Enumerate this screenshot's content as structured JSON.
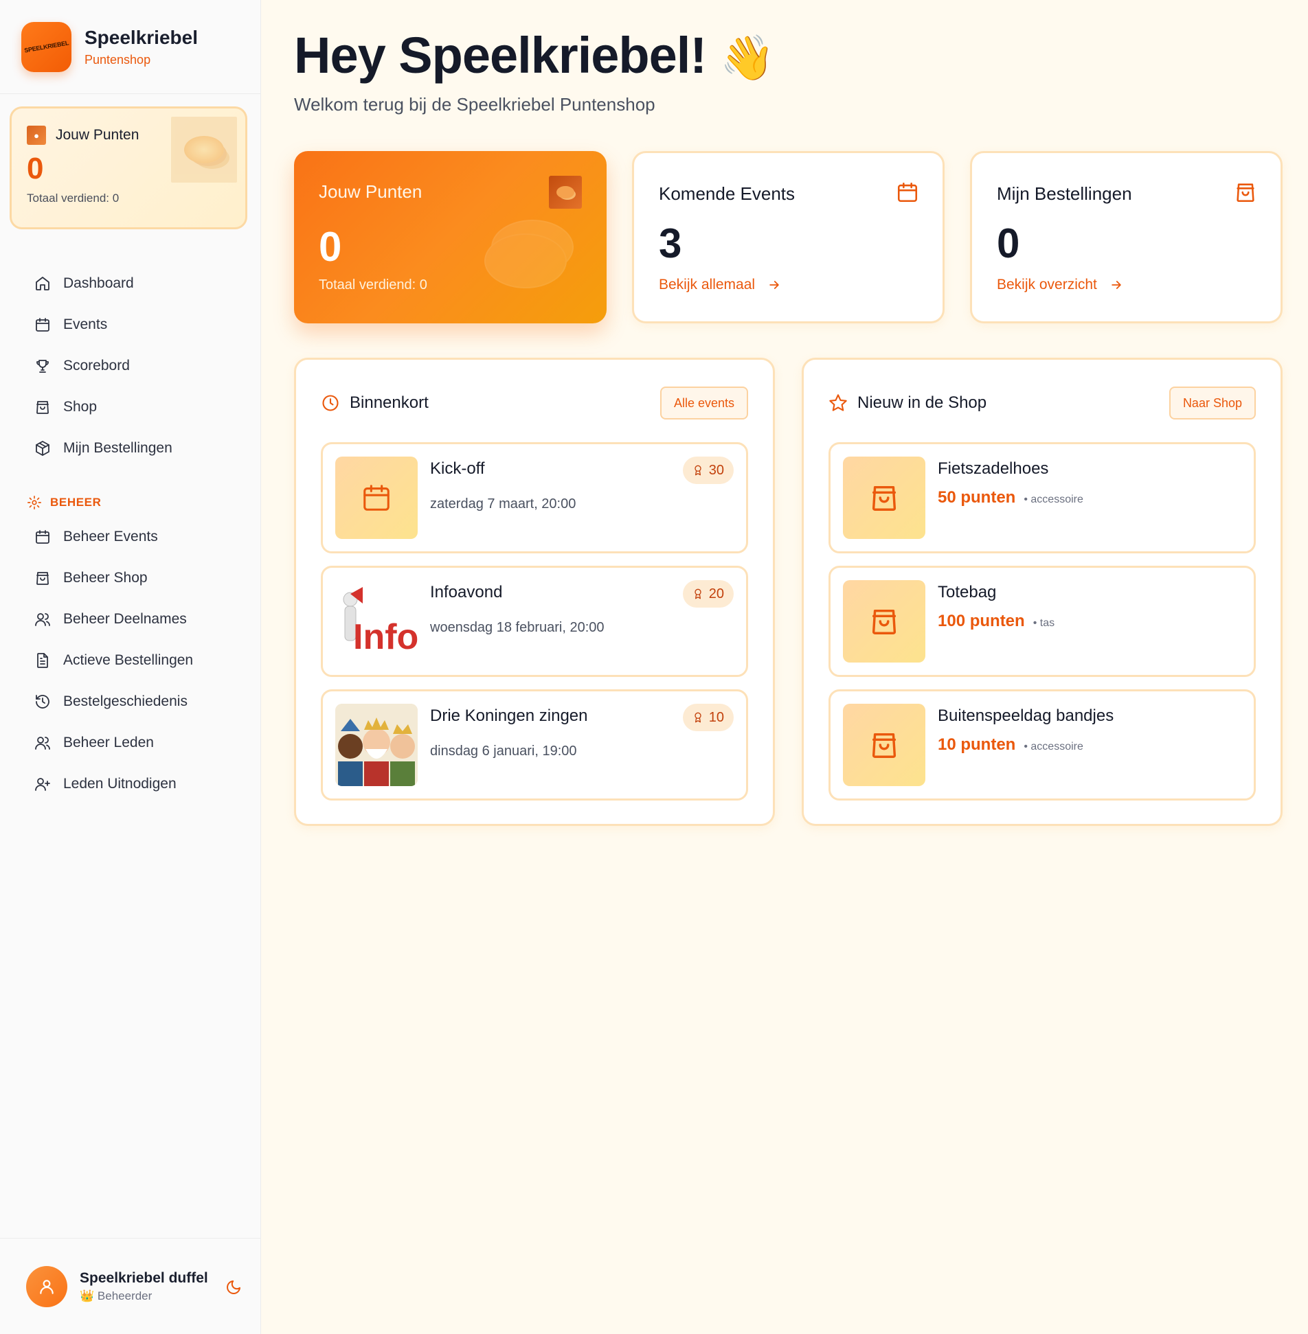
{
  "brand": {
    "name": "Speelkriebel",
    "subtitle": "Puntenshop",
    "logo_text": "SPEELKRIEBEL"
  },
  "sidebar_points": {
    "title": "Jouw Punten",
    "value": "0",
    "total": "Totaal verdiend: 0"
  },
  "nav": {
    "items": [
      {
        "label": "Dashboard",
        "icon": "home-icon"
      },
      {
        "label": "Events",
        "icon": "calendar-icon"
      },
      {
        "label": "Scorebord",
        "icon": "trophy-icon"
      },
      {
        "label": "Shop",
        "icon": "shopping-bag-icon"
      },
      {
        "label": "Mijn Bestellingen",
        "icon": "package-icon"
      }
    ],
    "section_label": "BEHEER",
    "admin_items": [
      {
        "label": "Beheer Events",
        "icon": "calendar-icon"
      },
      {
        "label": "Beheer Shop",
        "icon": "shopping-bag-icon"
      },
      {
        "label": "Beheer Deelnames",
        "icon": "users-icon"
      },
      {
        "label": "Actieve Bestellingen",
        "icon": "file-text-icon"
      },
      {
        "label": "Bestelgeschiedenis",
        "icon": "history-icon"
      },
      {
        "label": "Beheer Leden",
        "icon": "users-icon"
      },
      {
        "label": "Leden Uitnodigen",
        "icon": "user-plus-icon"
      }
    ]
  },
  "user": {
    "name": "Speelkriebel duffel",
    "role": "Beheerder",
    "role_emoji": "👑"
  },
  "header": {
    "greeting": "Hey Speelkriebel!",
    "wave_emoji": "👋",
    "welcome": "Welkom terug bij de Speelkriebel Puntenshop"
  },
  "stats": {
    "points": {
      "title": "Jouw Punten",
      "value": "0",
      "sub": "Totaal verdiend: 0"
    },
    "events": {
      "title": "Komende Events",
      "value": "3",
      "link": "Bekijk allemaal"
    },
    "orders": {
      "title": "Mijn Bestellingen",
      "value": "0",
      "link": "Bekijk overzicht"
    }
  },
  "upcoming": {
    "title": "Binnenkort",
    "button": "Alle events",
    "events": [
      {
        "name": "Kick-off",
        "date": "zaterdag 7 maart, 20:00",
        "points": "30"
      },
      {
        "name": "Infoavond",
        "date": "woensdag 18 februari, 20:00",
        "points": "20"
      },
      {
        "name": "Drie Koningen zingen",
        "date": "dinsdag 6 januari, 19:00",
        "points": "10"
      }
    ],
    "info_thumb_text": "Info"
  },
  "shop": {
    "title": "Nieuw in de Shop",
    "button": "Naar Shop",
    "items": [
      {
        "name": "Fietszadelhoes",
        "price": "50 punten",
        "category": "• accessoire"
      },
      {
        "name": "Totebag",
        "price": "100 punten",
        "category": "• tas"
      },
      {
        "name": "Buitenspeeldag bandjes",
        "price": "10 punten",
        "category": "• accessoire"
      }
    ]
  },
  "colors": {
    "accent": "#ea580c",
    "accent_light": "#f97316",
    "card_border": "#fde1b8",
    "background": "#fffaef"
  }
}
